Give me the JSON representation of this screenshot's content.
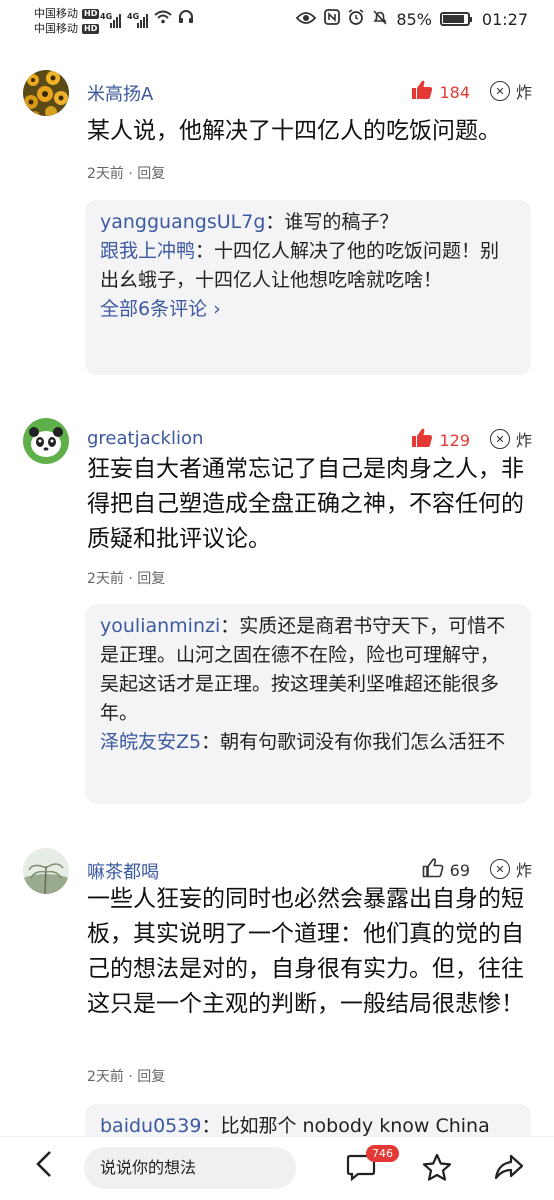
{
  "status_bar": {
    "carrier1": "中国移动",
    "carrier2": "中国移动",
    "hd": "HD",
    "net1": "4G",
    "net2": "4G",
    "battery": "85%",
    "time": "01:27"
  },
  "comments": [
    {
      "username": "米高扬A",
      "likes": "184",
      "zha": "炸",
      "text": "某人说，他解决了十四亿人的吃饭问题。",
      "time": "2天前",
      "reply_label": "回复",
      "replies": [
        {
          "name": "yangguangsUL7g",
          "sep": "：",
          "text": "谁写的稿子？"
        },
        {
          "name": "跟我上冲鸭",
          "sep": "：",
          "text": "十四亿人解决了他的吃饭问题！别出幺蛾子，十四亿人让他想吃啥就吃啥！"
        }
      ],
      "more": "全部6条评论 ›"
    },
    {
      "username": "greatjacklion",
      "likes": "129",
      "zha": "炸",
      "text": "狂妄自大者通常忘记了自己是肉身之人，非得把自己塑造成全盘正确之神，不容任何的质疑和批评议论。",
      "time": "2天前",
      "reply_label": "回复",
      "replies": [
        {
          "name": "youlianminzi",
          "sep": "：",
          "text": "实质还是商君书守天下，可惜不是正理。山河之固在德不在险，险也可理解守，吴起这话才是正理。按这理美利坚唯超还能很多年。"
        },
        {
          "name": "泽皖友安Z5",
          "sep": "：",
          "text": "朝有句歌词没有你我们怎么活狂不"
        }
      ]
    },
    {
      "username": "嘛茶都喝",
      "likes": "69",
      "zha": "炸",
      "text": "一些人狂妄的同时也必然会暴露出自身的短板，其实说明了一个道理：他们真的觉的自己的想法是对的，自身很有实力。但，往往这只是一个主观的判断，一般结局很悲惨！",
      "time": "2天前",
      "reply_label": "回复",
      "replies": [
        {
          "name": "baidu0539",
          "sep": "：",
          "text": "比如那个 nobody know China"
        }
      ]
    }
  ],
  "bottom_bar": {
    "input_placeholder": "说说你的想法",
    "comment_count": "746"
  }
}
